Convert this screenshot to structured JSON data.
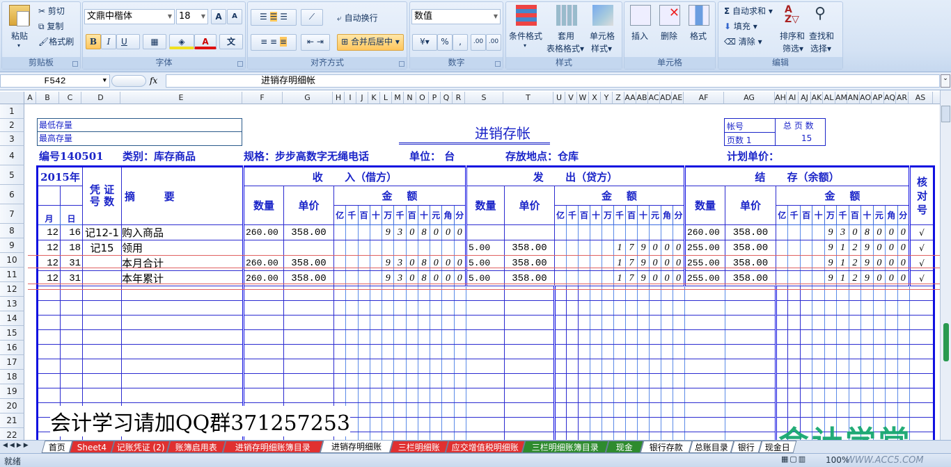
{
  "ribbon": {
    "clipboard": {
      "paste": "粘贴",
      "cut": "剪切",
      "copy": "复制",
      "format_painter": "格式刷",
      "label": "剪贴板"
    },
    "font": {
      "name": "文鼎中楷体",
      "size": "18",
      "bold": "B",
      "italic": "I",
      "underline": "U",
      "grow": "A",
      "shrink": "A",
      "font_color": "A",
      "phonetic": "文",
      "label": "字体"
    },
    "alignment": {
      "wrap_text": "自动换行",
      "merge_center": "合并后居中",
      "label": "对齐方式"
    },
    "number": {
      "format": "数值",
      "percent": "%",
      "comma": ",",
      "decimal": ".00",
      "label": "数字"
    },
    "styles": {
      "conditional": "条件格式",
      "table_format_1": "套用",
      "table_format_2": "表格格式",
      "cell_styles_1": "单元格",
      "cell_styles_2": "样式",
      "label": "样式"
    },
    "cells": {
      "insert": "插入",
      "delete": "删除",
      "format": "格式",
      "label": "单元格"
    },
    "editing": {
      "autosum": "自动求和",
      "fill": "填充",
      "clear": "清除",
      "sort_1": "排序和",
      "sort_2": "筛选",
      "find_1": "查找和",
      "find_2": "选择",
      "label": "编辑"
    }
  },
  "formula_bar": {
    "name_box": "F542",
    "fx": "fx",
    "content": "进销存明细帐"
  },
  "columns": [
    "A",
    "B",
    "C",
    "D",
    "E",
    "F",
    "G",
    "H",
    "I",
    "J",
    "K",
    "L",
    "M",
    "N",
    "O",
    "P",
    "Q",
    "R",
    "S",
    "T",
    "U",
    "V",
    "W",
    "X",
    "Y",
    "Z",
    "AA",
    "AB",
    "AC",
    "AD",
    "AE",
    "AF",
    "AG",
    "AH",
    "AI",
    "AJ",
    "AK",
    "AL",
    "AM",
    "AN",
    "AO",
    "AP",
    "AQ",
    "AR",
    "AS",
    "A"
  ],
  "rows": [
    "1",
    "2",
    "3",
    "4",
    "5",
    "6",
    "7",
    "8",
    "9",
    "10",
    "11",
    "12",
    "13",
    "14",
    "15",
    "16",
    "17",
    "18",
    "19",
    "20",
    "21",
    "22"
  ],
  "form": {
    "min_stock": "最低存量",
    "max_stock": "最高存量",
    "title": "进销存帐",
    "account_no": "帐号",
    "total_pages": "总 页 数",
    "page": "页数 1",
    "total_pages_value": "15",
    "code": "编号140501",
    "category": "类别：库存商品",
    "spec": "规格：步步高数字无绳电话",
    "unit": "单位：  台",
    "location": "存放地点：仓库",
    "plan_price": "计划单价："
  },
  "ledger_header": {
    "year": "2015年",
    "voucher": "凭 证\n号 数",
    "summary": "摘        要",
    "income": "收      入（借方）",
    "outgo": "发      出（贷方）",
    "balance": "结      存（余额）",
    "check": "核对号",
    "qty": "数量",
    "price": "单价",
    "amount": "金    额",
    "month": "月",
    "day": "日",
    "digits": [
      "亿",
      "千",
      "百",
      "十",
      "万",
      "千",
      "百",
      "十",
      "元",
      "角",
      "分"
    ]
  },
  "ledger_rows": [
    {
      "month": "12",
      "day": "16",
      "voucher": "记12-1",
      "summary": "购入商品",
      "in_qty": "260.00",
      "in_price": "358.00",
      "in_amt": [
        "",
        "",
        "",
        "",
        "9",
        "3",
        "0",
        "8",
        "0",
        "0",
        "0"
      ],
      "out_qty": "",
      "out_price": "",
      "out_amt": [
        "",
        "",
        "",
        "",
        "",
        "",
        "",
        "",
        "",
        "",
        ""
      ],
      "bal_qty": "260.00",
      "bal_price": "358.00",
      "bal_amt": [
        "",
        "",
        "",
        "",
        "9",
        "3",
        "0",
        "8",
        "0",
        "0",
        "0"
      ],
      "check": "√"
    },
    {
      "month": "12",
      "day": "18",
      "voucher": "记15",
      "summary": "领用",
      "in_qty": "",
      "in_price": "",
      "in_amt": [
        "",
        "",
        "",
        "",
        "",
        "",
        "",
        "",
        "",
        "",
        ""
      ],
      "out_qty": "5.00",
      "out_price": "358.00",
      "out_amt": [
        "",
        "",
        "",
        "",
        "",
        "1",
        "7",
        "9",
        "0",
        "0",
        "0"
      ],
      "bal_qty": "255.00",
      "bal_price": "358.00",
      "bal_amt": [
        "",
        "",
        "",
        "",
        "9",
        "1",
        "2",
        "9",
        "0",
        "0",
        "0"
      ],
      "check": "√"
    },
    {
      "month": "12",
      "day": "31",
      "voucher": "",
      "summary": "本月合计",
      "in_qty": "260.00",
      "in_price": "358.00",
      "in_amt": [
        "",
        "",
        "",
        "",
        "9",
        "3",
        "0",
        "8",
        "0",
        "0",
        "0"
      ],
      "out_qty": "5.00",
      "out_price": "358.00",
      "out_amt": [
        "",
        "",
        "",
        "",
        "",
        "1",
        "7",
        "9",
        "0",
        "0",
        "0"
      ],
      "bal_qty": "255.00",
      "bal_price": "358.00",
      "bal_amt": [
        "",
        "",
        "",
        "",
        "9",
        "1",
        "2",
        "9",
        "0",
        "0",
        "0"
      ],
      "check": "√"
    },
    {
      "month": "12",
      "day": "31",
      "voucher": "",
      "summary": "本年累计",
      "in_qty": "260.00",
      "in_price": "358.00",
      "in_amt": [
        "",
        "",
        "",
        "",
        "9",
        "3",
        "0",
        "8",
        "0",
        "0",
        "0"
      ],
      "out_qty": "5.00",
      "out_price": "358.00",
      "out_amt": [
        "",
        "",
        "",
        "",
        "",
        "1",
        "7",
        "9",
        "0",
        "0",
        "0"
      ],
      "bal_qty": "255.00",
      "bal_price": "358.00",
      "bal_amt": [
        "",
        "",
        "",
        "",
        "9",
        "1",
        "2",
        "9",
        "0",
        "0",
        "0"
      ],
      "check": "√"
    }
  ],
  "overlay_caption": "会计学习请加QQ群371257253",
  "watermark": {
    "logo": "会计学堂",
    "url": "WWW.ACC5.COM"
  },
  "sheet_tabs": [
    {
      "label": "首页",
      "color": "#ffffff"
    },
    {
      "label": "Sheet4",
      "color": "#e03030"
    },
    {
      "label": "记账凭证 (2)",
      "color": "#e03030"
    },
    {
      "label": "账簿启用表",
      "color": "#e03030"
    },
    {
      "label": "进销存明细账簿目录",
      "color": "#e03030"
    },
    {
      "label": "进销存明细账",
      "color": "#ffffff",
      "active": true
    },
    {
      "label": "三栏明细账",
      "color": "#e03030"
    },
    {
      "label": "应交增值税明细账",
      "color": "#e03030"
    },
    {
      "label": "三栏明细账簿目录",
      "color": "#2e8b2e"
    },
    {
      "label": "现金",
      "color": "#2e8b2e"
    },
    {
      "label": "银行存款",
      "color": "#ffffff"
    },
    {
      "label": "总账目录",
      "color": "#ffffff"
    },
    {
      "label": "银行",
      "color": "#ffffff"
    },
    {
      "label": "现金日",
      "color": "#ffffff"
    }
  ],
  "status": {
    "ready": "就绪",
    "zoom": "100%"
  }
}
